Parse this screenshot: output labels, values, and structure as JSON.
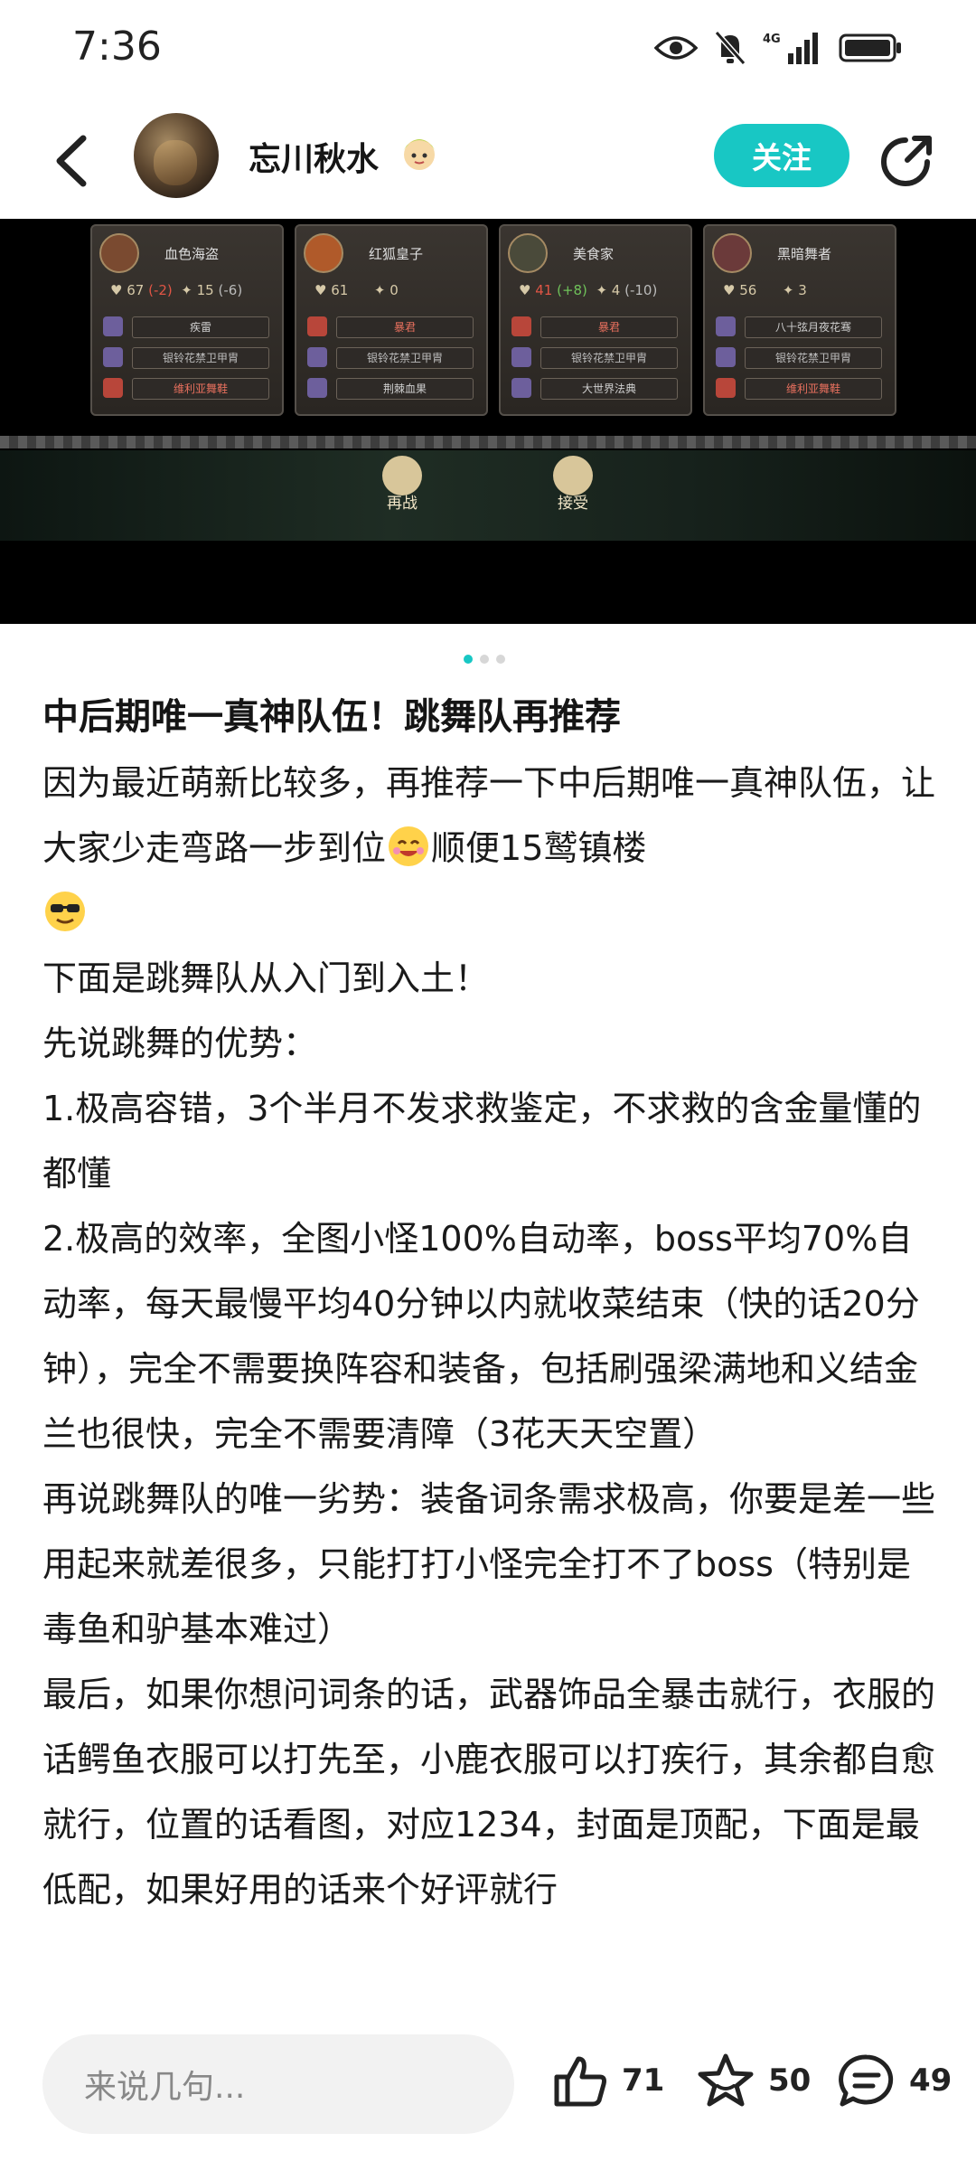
{
  "status_bar": {
    "time": "7:36",
    "network": "4G"
  },
  "header": {
    "username": "忘川秋水",
    "follow_label": "关注"
  },
  "game": {
    "cards": [
      {
        "name": "血色海盗",
        "stat1": "67",
        "stat1_delta": "(-2)",
        "stat2": "15",
        "stat2_delta": "(-6)",
        "slots": [
          "疾雷",
          "银铃花禁卫甲胄",
          "维利亚舞鞋"
        ]
      },
      {
        "name": "红狐皇子",
        "stat1": "61",
        "stat1_delta": "",
        "stat2": "0",
        "stat2_delta": "",
        "slots": [
          "暴君",
          "银铃花禁卫甲胄",
          "荆棘血果"
        ]
      },
      {
        "name": "美食家",
        "stat1": "41",
        "stat1_delta": "(+8)",
        "stat2": "4",
        "stat2_delta": "(-10)",
        "slots": [
          "暴君",
          "银铃花禁卫甲胄",
          "大世界法典"
        ]
      },
      {
        "name": "黑暗舞者",
        "stat1": "56",
        "stat1_delta": "",
        "stat2": "3",
        "stat2_delta": "",
        "slots": [
          "八十弦月夜花骞",
          "银铃花禁卫甲胄",
          "维利亚舞鞋"
        ]
      }
    ],
    "buttons": [
      "再战",
      "接受"
    ]
  },
  "carousel": {
    "total": 3,
    "active": 1
  },
  "article": {
    "title": "中后期唯一真神队伍！跳舞队再推荐",
    "paragraphs": [
      "因为最近萌新比较多，再推荐一下中后期唯一真神队伍，让大家少走弯路一步到位",
      "顺便15鹫镇楼",
      "下面是跳舞队从入门到入土！",
      "先说跳舞的优势：",
      "1.极高容错，3个半月不发求救鉴定，不求救的含金量懂的都懂",
      "2.极高的效率，全图小怪100%自动率，boss平均70%自动率，每天最慢平均40分钟以内就收菜结束（快的话20分钟），完全不需要换阵容和装备，包括刷强梁满地和义结金兰也很快，完全不需要清障（3花天天空置）",
      "再说跳舞队的唯一劣势：装备词条需求极高，你要是差一些用起来就差很多，只能打打小怪完全打不了boss（特别是毒鱼和驴基本难过）",
      "最后，如果你想问词条的话，武器饰品全暴击就行，衣服的话鳄鱼衣服可以打先至，小鹿衣服可以打疾行，其余都自愈就行，位置的话看图，对应1234，封面是顶配，下面是最低配，如果好用的话来个好评就行"
    ]
  },
  "bottom_bar": {
    "comment_placeholder": "来说几句...",
    "likes": "71",
    "favorites": "50",
    "comments": "49"
  },
  "colors": {
    "accent": "#18c7c4"
  }
}
